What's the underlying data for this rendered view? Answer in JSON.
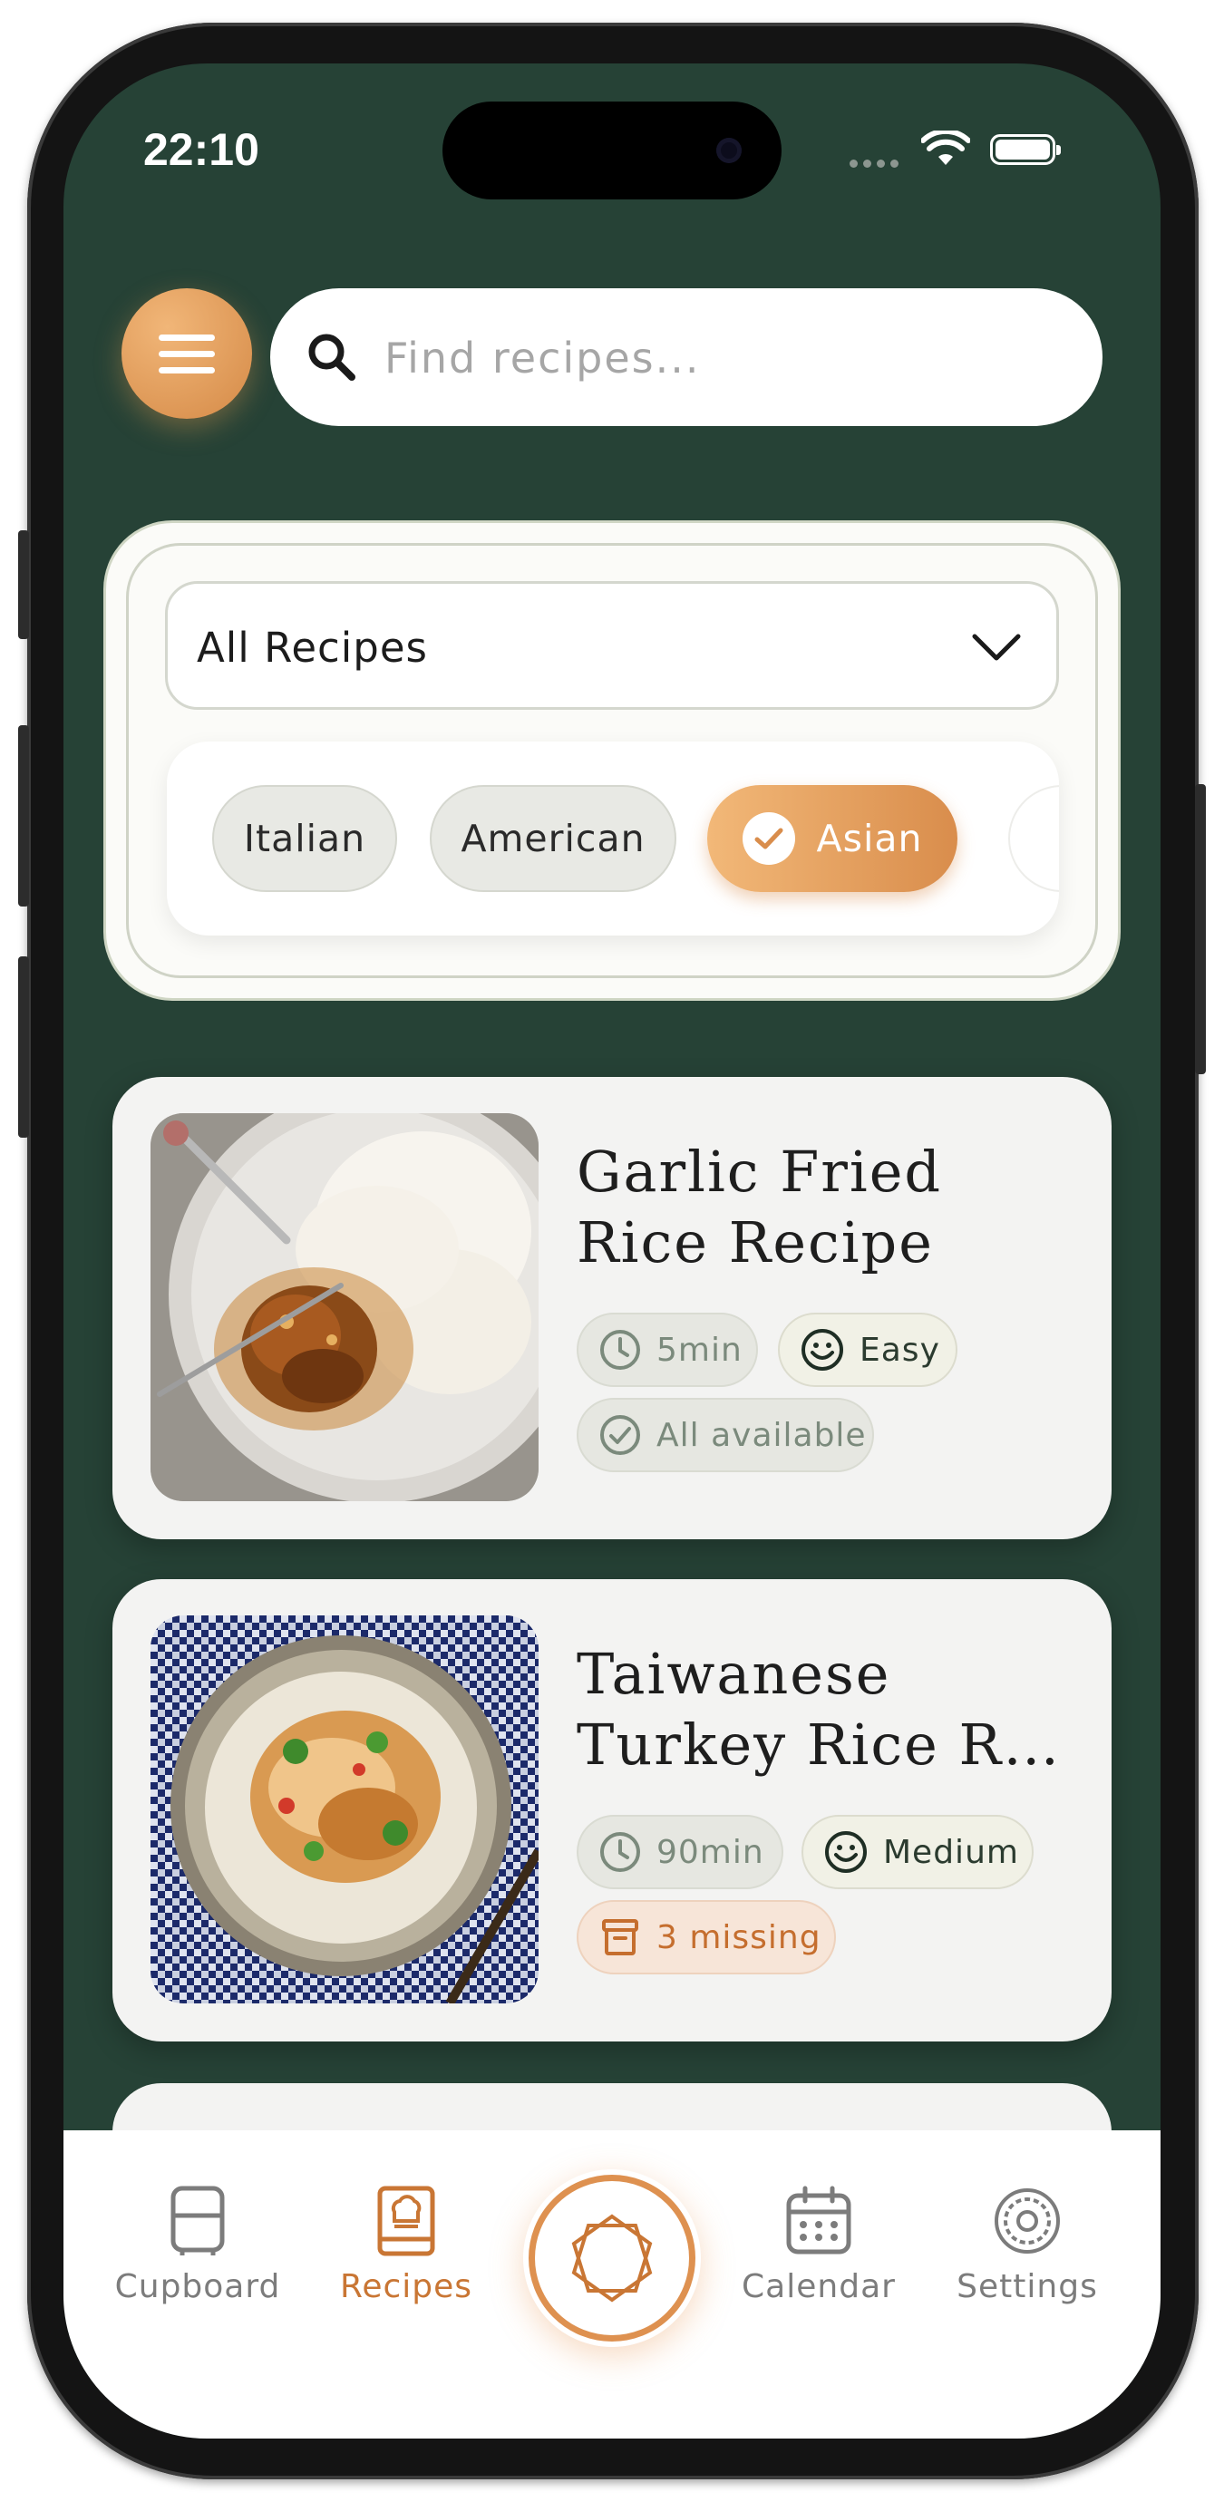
{
  "status_bar": {
    "time": "22:10"
  },
  "header": {
    "menu_icon": "hamburger-menu-icon",
    "search": {
      "placeholder": "Find recipes...",
      "value": "",
      "icon": "search-icon"
    }
  },
  "filter": {
    "dropdown": {
      "selected": "All Recipes",
      "icon": "chevron-down-icon"
    },
    "chips": [
      {
        "label": "Italian",
        "selected": false
      },
      {
        "label": "American",
        "selected": false
      },
      {
        "label": "Asian",
        "selected": true
      }
    ]
  },
  "recipes": [
    {
      "title_line1": "Garlic Fried",
      "title_line2": "Rice Recipe",
      "time": "5min",
      "difficulty": "Easy",
      "availability": "All available",
      "availability_status": "available"
    },
    {
      "title_line1": "Taiwanese",
      "title_line2": "Turkey Rice Re…",
      "time": "90min",
      "difficulty": "Medium",
      "availability": "3 missing",
      "availability_status": "missing"
    }
  ],
  "tab_bar": {
    "tabs": [
      {
        "label": "Cupboard",
        "icon": "fridge-icon",
        "active": false
      },
      {
        "label": "Recipes",
        "icon": "cookbook-icon",
        "active": true
      },
      {
        "label": "Calendar",
        "icon": "calendar-icon",
        "active": false
      },
      {
        "label": "Settings",
        "icon": "gear-icon",
        "active": false
      }
    ],
    "center_button_icon": "star-knot-icon"
  },
  "colors": {
    "background": "#264236",
    "accent": "#d98d4c",
    "card": "#f3f3f2",
    "missing": "#c56e2e"
  }
}
